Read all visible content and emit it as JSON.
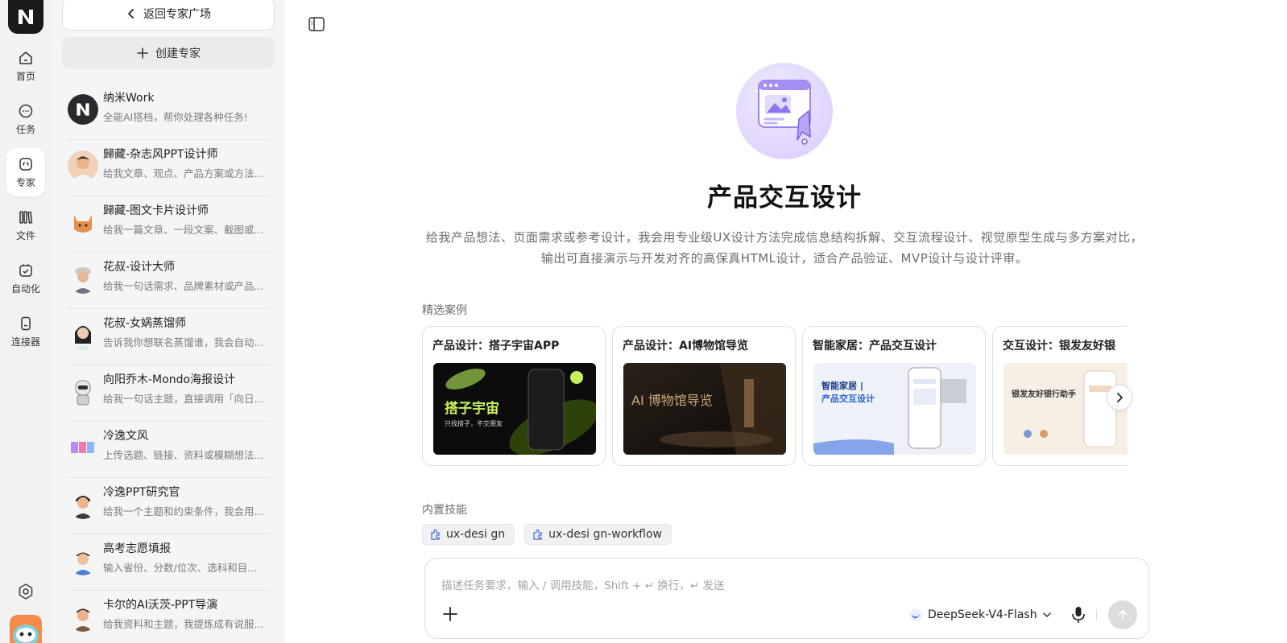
{
  "rail": {
    "items": [
      {
        "label": "首页",
        "icon": "home-icon"
      },
      {
        "label": "任务",
        "icon": "chat-icon"
      },
      {
        "label": "专家",
        "icon": "expert-icon"
      },
      {
        "label": "文件",
        "icon": "books-icon"
      },
      {
        "label": "自动化",
        "icon": "calendar-check-icon"
      },
      {
        "label": "连接器",
        "icon": "device-icon"
      }
    ],
    "active": "专家"
  },
  "panel": {
    "back_label": "返回专家广场",
    "create_label": "创建专家",
    "experts": [
      {
        "name": "纳米Work",
        "desc": "全能AI搭档，帮你处理各种任务!"
      },
      {
        "name": "歸藏-杂志风PPT设计师",
        "desc": "给我文章、观点、产品方案或方法..."
      },
      {
        "name": "歸藏-图文卡片设计师",
        "desc": "给我一篇文章、一段文案、截图或..."
      },
      {
        "name": "花叔-设计大师",
        "desc": "给我一句话需求、品牌素材或产品..."
      },
      {
        "name": "花叔-女娲蒸馏师",
        "desc": "告诉我你想联名蒸馏谁，我会自动..."
      },
      {
        "name": "向阳乔木-Mondo海报设计",
        "desc": "给我一句话主题，直接调用「向日..."
      },
      {
        "name": "冷逸文风",
        "desc": "上传选题、链接、资料或模糊想法..."
      },
      {
        "name": "冷逸PPT研究官",
        "desc": "给我一个主题和约束条件，我会用..."
      },
      {
        "name": "高考志愿填报",
        "desc": "输入省份、分数/位次、选科和目..."
      },
      {
        "name": "卡尔的AI沃茨-PPT导演",
        "desc": "给我资料和主题，我提炼成有说服..."
      }
    ]
  },
  "main": {
    "title": "产品交互设计",
    "description": "给我产品想法、页面需求或参考设计，我会用专业级UX设计方法完成信息结构拆解、交互流程设计、视觉原型生成与多方案对比，输出可直接演示与开发对齐的高保真HTML设计，适合产品验证、MVP设计与设计评审。",
    "cases_label": "精选案例",
    "cases": [
      {
        "title": "产品设计：搭子宇宙APP",
        "thumb_text": "搭子宇宙",
        "thumb_sub": "只找搭子，不交朋友"
      },
      {
        "title": "产品设计：AI博物馆导览",
        "thumb_text": "AI 博物馆导览",
        "thumb_sub": ""
      },
      {
        "title": "智能家居：产品交互设计",
        "thumb_text": "智能家居 |",
        "thumb_sub": "产品交互设计"
      },
      {
        "title": "交互设计：银发友好银",
        "thumb_text": "银发友好银行助手",
        "thumb_sub": ""
      }
    ],
    "skills_label": "内置技能",
    "skills": [
      "ux-desi gn",
      "ux-desi gn-workflow"
    ]
  },
  "composer": {
    "placeholder": "描述任务要求，输入 / 调用技能，Shift + ↵ 换行，↵ 发送",
    "model": "DeepSeek-V4-Flash"
  }
}
